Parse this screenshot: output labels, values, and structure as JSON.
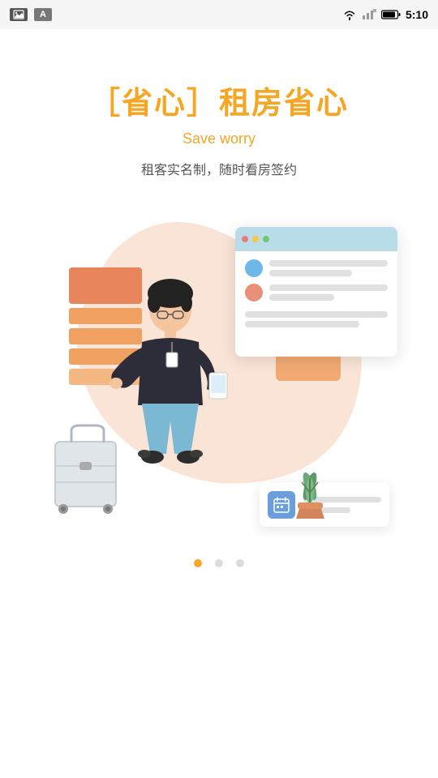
{
  "statusBar": {
    "time": "5:10"
  },
  "page": {
    "titleChinese": "［省心］租房省心",
    "titleEnglish": "Save worry",
    "subtitleChinese": "租客实名制，随时看房签约"
  },
  "pagination": {
    "dots": [
      {
        "active": true
      },
      {
        "active": false
      },
      {
        "active": false
      }
    ]
  },
  "docPanel": {
    "headerDots": [
      "red",
      "yellow",
      "green"
    ],
    "rows": [
      {
        "circleColor": "blue"
      },
      {
        "circleColor": "salmon"
      }
    ]
  }
}
